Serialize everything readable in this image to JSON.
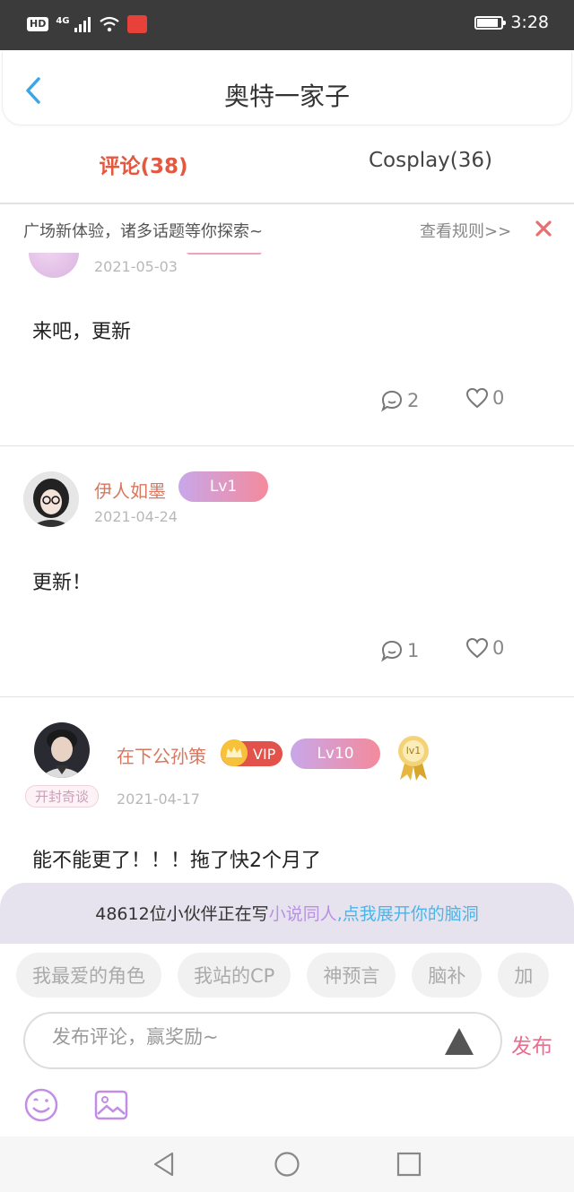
{
  "status_bar": {
    "hd": "HD",
    "network": "4G",
    "time": "3:28",
    "battery_level": 0.9
  },
  "header": {
    "title": "奥特一家子"
  },
  "tabs": [
    {
      "label": "评论(38)"
    },
    {
      "label": "Cosplay(36)"
    }
  ],
  "notice": {
    "text": "广场新体验，诸多话题等你探索~",
    "rules_link": "查看规则>>"
  },
  "posts": [
    {
      "date": "2021-05-03",
      "content": "来吧，更新",
      "comments": "2",
      "likes": "0"
    },
    {
      "username": "伊人如墨",
      "level": "Lv1",
      "date": "2021-04-24",
      "content": "更新！",
      "comments": "1",
      "likes": "0"
    },
    {
      "username": "在下公孙策",
      "vip": "VIP",
      "level": "Lv10",
      "medal": "lv1",
      "tag": "开封奇谈",
      "date": "2021-04-17",
      "content": "能不能更了！！！拖了快2个月了"
    }
  ],
  "invite": {
    "prefix": "48612位小伙伴正在写",
    "highlight1": "小说同人",
    "highlight2": ",点我展开你的脑洞"
  },
  "composer": {
    "chips": [
      "我最爱的角色",
      "我站的CP",
      "神预言",
      "脑补",
      "加"
    ],
    "placeholder": "发布评论，赢奖励~",
    "publish_label": "发布"
  },
  "colors": {
    "accent_red": "#e5573f",
    "username": "#d8775f",
    "publish_pink": "#e86f8f",
    "invite_purple": "#b891e3",
    "invite_blue": "#4cb4e8"
  }
}
